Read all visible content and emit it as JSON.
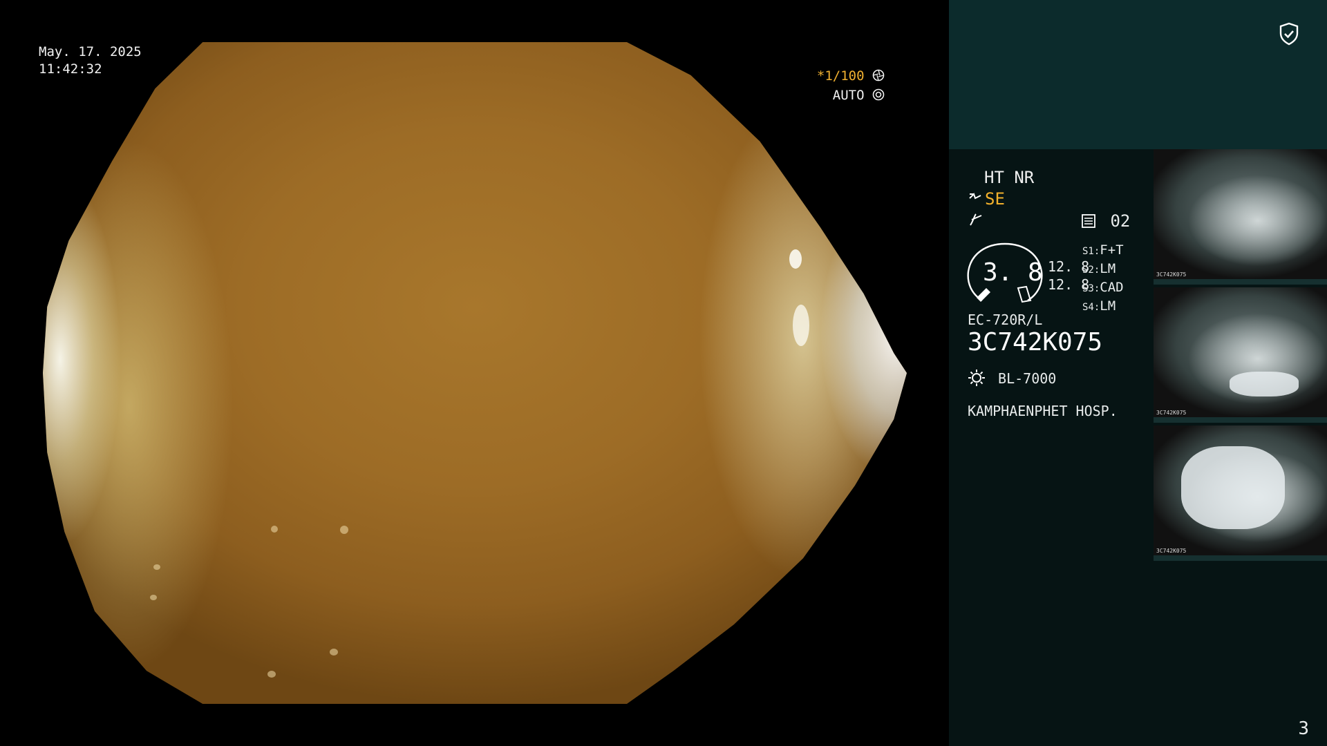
{
  "overlay": {
    "date": "May. 17. 2025",
    "time": "11:42:32",
    "shutter": "*1/100",
    "shutter_icon": "aperture-icon",
    "auto": "AUTO",
    "auto_icon": "iris-icon"
  },
  "panel": {
    "shield_icon": "shield-check-icon",
    "mode": "HT NR",
    "se": "SE",
    "channel": "02",
    "dial_value": "3. 8",
    "values": [
      "12. 8",
      "12. 8"
    ],
    "slots": [
      {
        "label": "S1",
        "value": "F+T"
      },
      {
        "label": "S2",
        "value": "LM"
      },
      {
        "label": "S3",
        "value": "CAD"
      },
      {
        "label": "S4",
        "value": "LM"
      }
    ],
    "model": "EC-720R/L",
    "serial": "3C742K075",
    "light_source": "BL-7000",
    "hospital": "KAMPHAENPHET HOSP.",
    "page_number": "3"
  },
  "thumbnails": [
    {
      "label": "3C742K075"
    },
    {
      "label": "3C742K075"
    },
    {
      "label": "3C742K075"
    }
  ],
  "colors": {
    "accent": "#f2b12c",
    "panel_bg": "#061414",
    "panel_top": "#0c2b2c"
  }
}
